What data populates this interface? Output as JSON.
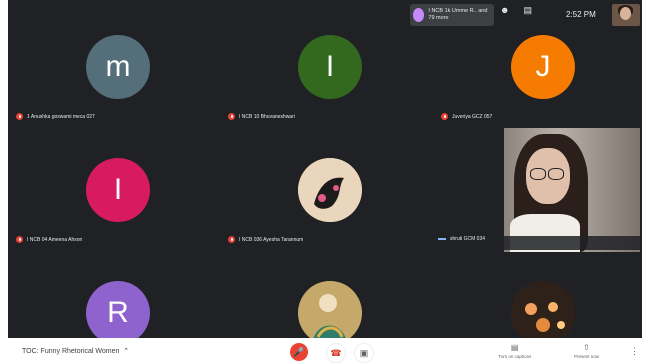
{
  "top_bar": {
    "people_chip": "I NCB 1k Umme R.. and 79 more",
    "clock": "2:52 PM",
    "icons": [
      "people-icon",
      "chat-icon"
    ]
  },
  "participants": [
    {
      "initial": "m",
      "name": "1 Anushka goswami meca 027",
      "color": "#546e7a"
    },
    {
      "initial": "I",
      "name": "I NCB 10 Bhuvaneshwari",
      "color": "#33691e"
    },
    {
      "initial": "J",
      "name": "Juveriya GCZ 057",
      "color": "#f57c00"
    },
    {
      "initial": "I",
      "name": "I NCB 04 Ameena Ahson",
      "color": "#d81b60"
    },
    {
      "initial": "",
      "name": "I NCB 036 Ayesha Tarannum",
      "color": "#e6cfb3"
    },
    {
      "initial": "",
      "name": "shruti GCM 034",
      "color": ""
    },
    {
      "initial": "R",
      "name": "",
      "color": "#8e63ce"
    },
    {
      "initial": "",
      "name": "",
      "color": "#b89a52"
    },
    {
      "initial": "",
      "name": "",
      "color": "#3a2a20"
    }
  ],
  "bottom_bar": {
    "meeting_title": "TOC: Funny Rhetorical Women",
    "captions_label": "Turn on captions",
    "present_label": "Present now"
  }
}
